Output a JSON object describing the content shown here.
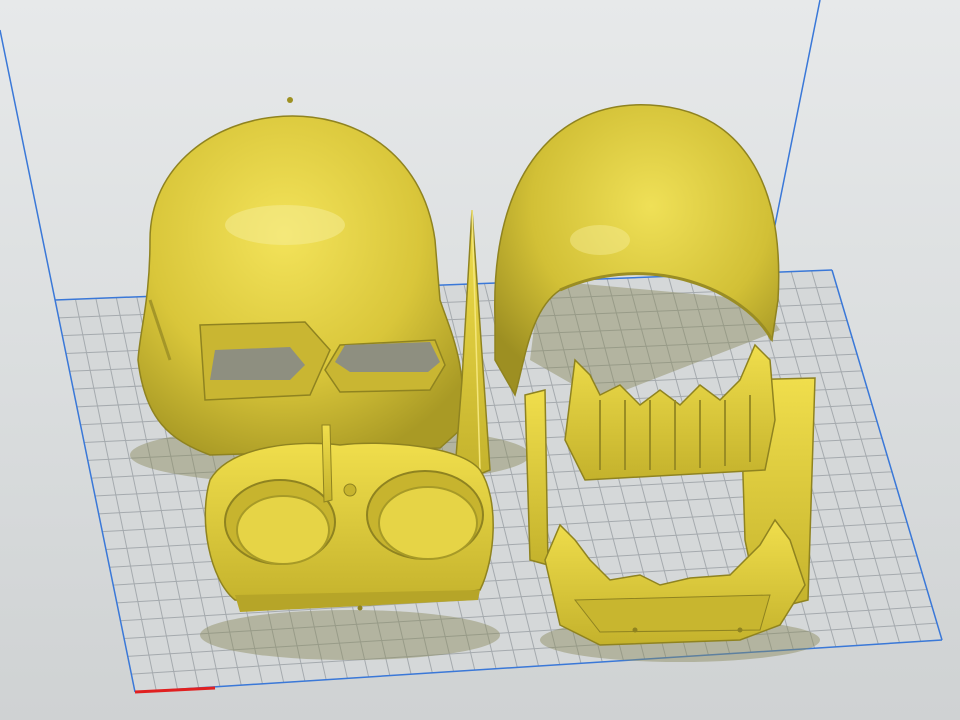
{
  "viewport": {
    "background_color": "#dcdfe0",
    "build_volume_edge_color": "#3a78d8",
    "grid_line_color": "#9ea3a8",
    "axis_x_color": "#e02020",
    "model_color": "#d6c437",
    "model_shadow_color": "#8d8a4a"
  },
  "models": [
    {
      "name": "helmet-front-shell"
    },
    {
      "name": "helmet-back-shell"
    },
    {
      "name": "ear-fin-spike"
    },
    {
      "name": "goggle-lens-frame"
    },
    {
      "name": "jaw-teeth-assembly"
    }
  ]
}
